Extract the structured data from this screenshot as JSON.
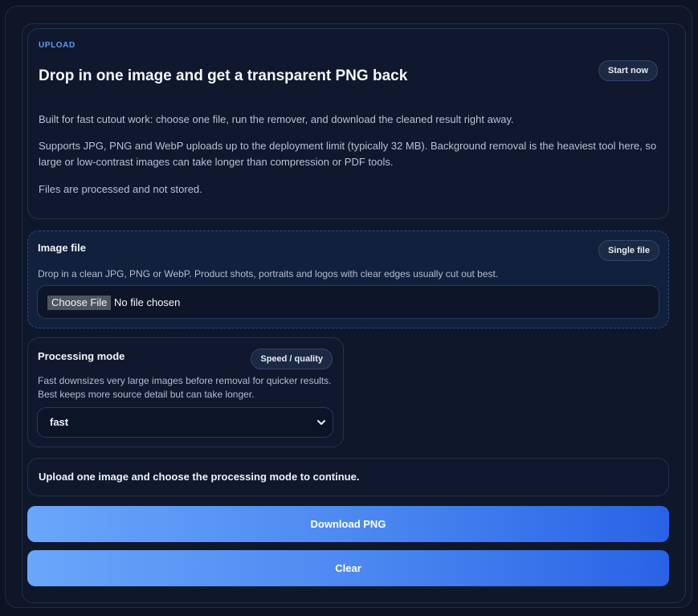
{
  "intro": {
    "eyebrow": "UPLOAD",
    "headline": "Drop in one image and get a transparent PNG back",
    "cta_label": "Start now",
    "paragraphs": [
      "Built for fast cutout work: choose one file, run the remover, and download the cleaned result right away.",
      "Supports JPG, PNG and WebP uploads up to the deployment limit (typically 32 MB). Background removal is the heaviest tool here, so large or low-contrast images can take longer than compression or PDF tools.",
      "Files are processed and not stored."
    ]
  },
  "image_file": {
    "title": "Image file",
    "badge": "Single file",
    "description": "Drop in a clean JPG, PNG or WebP. Product shots, portraits and logos with clear edges usually cut out best.",
    "choose_label": "Choose File",
    "file_status": "No file chosen"
  },
  "processing_mode": {
    "title": "Processing mode",
    "badge": "Speed / quality",
    "description": "Fast downsizes very large images before removal for quicker results. Best keeps more source detail but can take longer.",
    "selected": "fast"
  },
  "status": {
    "message": "Upload one image and choose the processing mode to continue."
  },
  "actions": {
    "download_label": "Download PNG",
    "clear_label": "Clear"
  },
  "colors": {
    "accent": "#5a9bf6",
    "button_gradient_start": "#6aa6fa",
    "button_gradient_end": "#2a62e6",
    "background": "#0c1424"
  },
  "icons": {
    "select_arrow": "chevron-down-icon"
  }
}
